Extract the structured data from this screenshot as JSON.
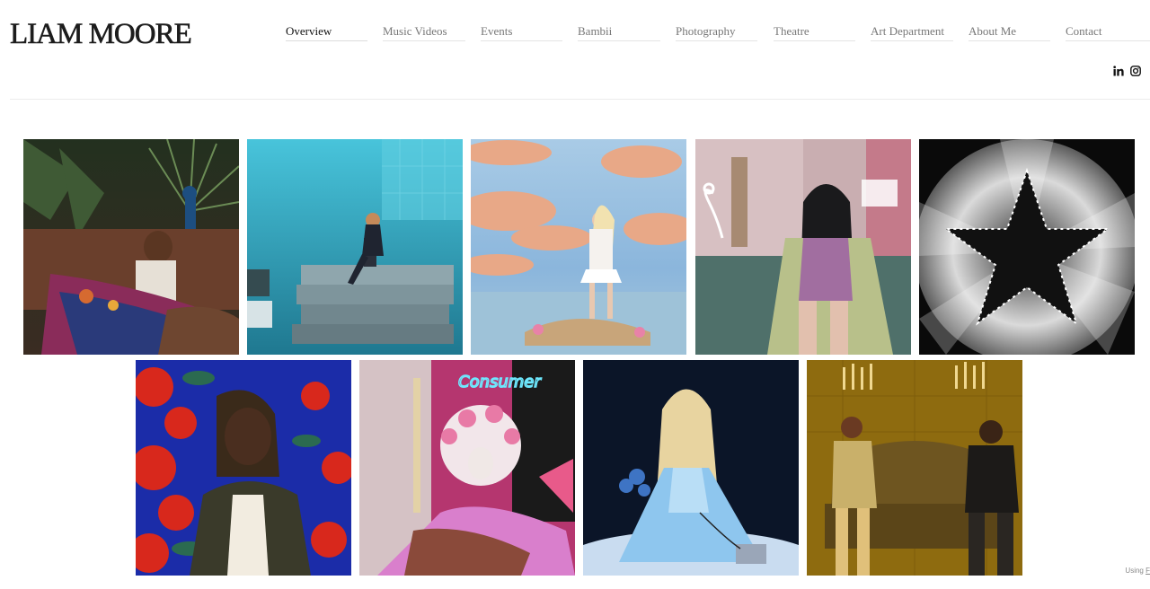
{
  "header": {
    "site_title": "LIAM MOORE",
    "nav": [
      {
        "label": "Overview",
        "active": true
      },
      {
        "label": "Music Videos"
      },
      {
        "label": "Events"
      },
      {
        "label": "Bambii"
      },
      {
        "label": "Photography"
      },
      {
        "label": "Theatre"
      },
      {
        "label": "Art Department"
      },
      {
        "label": "About Me"
      },
      {
        "label": "Contact"
      }
    ],
    "social": [
      "linkedin-icon",
      "instagram-icon"
    ]
  },
  "gallery": {
    "images": [
      {
        "name": "peacock-jungle-portrait",
        "palette": [
          "#2c3b2a",
          "#4a3a2e"
        ]
      },
      {
        "name": "blue-mattress-stack",
        "palette": [
          "#3fb6cc",
          "#1f7f96"
        ]
      },
      {
        "name": "pink-cloud-island",
        "palette": [
          "#9ec5e6",
          "#e8a58a"
        ]
      },
      {
        "name": "flamingo-neon-room",
        "palette": [
          "#c9b0b4",
          "#4f6e6b"
        ]
      },
      {
        "name": "star-light-sculpture",
        "palette": [
          "#0a0a0a",
          "#d9d9d9"
        ]
      },
      {
        "name": "red-flowers-portrait",
        "palette": [
          "#1f2fb0",
          "#d82a1e"
        ]
      },
      {
        "name": "neon-sign-floral-headdress",
        "palette": [
          "#b23a7a",
          "#e6a9d6"
        ]
      },
      {
        "name": "blue-dress-gamer",
        "palette": [
          "#0c1528",
          "#7fb2e6"
        ]
      },
      {
        "name": "candle-sofa-duo",
        "palette": [
          "#9a7410",
          "#5a3e10"
        ]
      }
    ]
  },
  "footer": {
    "prefix": "Using ",
    "link": "F"
  }
}
